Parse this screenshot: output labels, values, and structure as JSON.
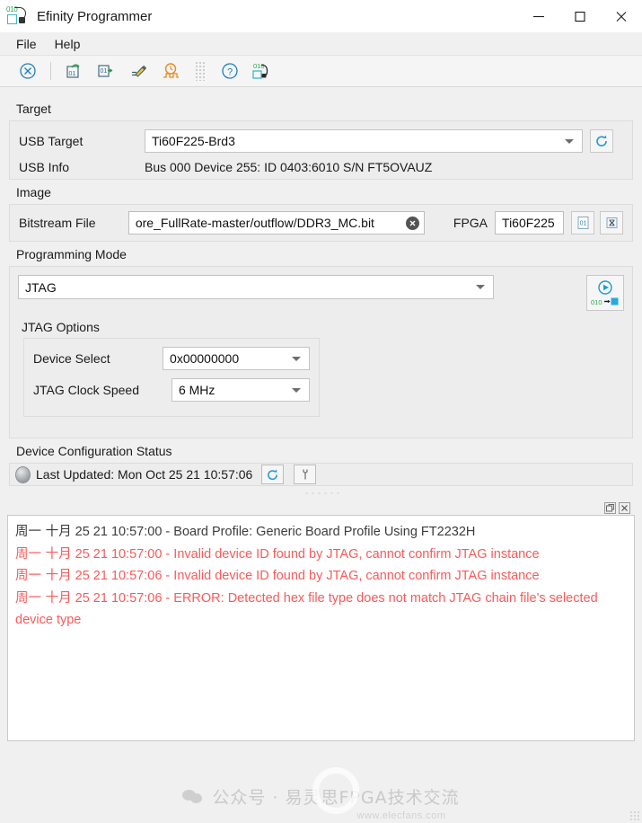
{
  "window": {
    "title": "Efinity Programmer",
    "icon": "efinity-programmer-icon",
    "controls": {
      "minimize": "minimize",
      "maximize": "maximize",
      "close": "close"
    }
  },
  "menubar": {
    "items": [
      {
        "label": "File"
      },
      {
        "label": "Help"
      }
    ]
  },
  "toolbar": {
    "buttons": [
      {
        "name": "stop-button",
        "icon": "circle-x-icon"
      },
      {
        "name": "load-bitstream-button",
        "icon": "open-01-up-arrow-icon"
      },
      {
        "name": "export-bitstream-button",
        "icon": "01-right-arrow-icon"
      },
      {
        "name": "edit-jtag-chain-button",
        "icon": "pencil-edit-icon"
      },
      {
        "name": "timing-button",
        "icon": "clock-waveform-icon"
      },
      {
        "name": "help-button",
        "icon": "question-circle-icon"
      },
      {
        "name": "about-button",
        "icon": "010-plug-icon"
      }
    ]
  },
  "target": {
    "section_label": "Target",
    "usb_target_label": "USB Target",
    "usb_target_value": "Ti60F225-Brd3",
    "refresh_icon": "refresh-icon",
    "usb_info_label": "USB Info",
    "usb_info_value": "Bus 000 Device 255: ID 0403:6010 S/N FT5OVAUZ"
  },
  "image": {
    "section_label": "Image",
    "bitstream_label": "Bitstream File",
    "bitstream_value": "ore_FullRate-master/outflow/DDR3_MC.bit",
    "clear_icon": "clear-circle-x-icon",
    "fpga_label": "FPGA",
    "fpga_value": "Ti60F225",
    "buttons": [
      {
        "name": "select-bitstream-button",
        "icon": "document-01-icon"
      },
      {
        "name": "jtag-chain-button",
        "icon": "device-chain-icon"
      }
    ]
  },
  "programming_mode": {
    "section_label": "Programming Mode",
    "mode_value": "JTAG",
    "start_program_button": {
      "name": "start-program-button",
      "icon": "play-program-icon",
      "badge": "010"
    },
    "options_label": "JTAG Options",
    "fields": [
      {
        "label": "Device Select",
        "value": "0x00000000"
      },
      {
        "label": "JTAG Clock Speed",
        "value": "6 MHz"
      }
    ]
  },
  "device_status": {
    "section_label": "Device Configuration Status",
    "led": "status-led-idle",
    "text": "Last Updated: Mon Oct 25 21 10:57:06",
    "buttons": [
      {
        "name": "refresh-status-button",
        "icon": "refresh-icon"
      },
      {
        "name": "configure-status-button",
        "icon": "wrench-icon"
      }
    ]
  },
  "dock": {
    "float_button": "float-panel-icon",
    "close_button": "close-panel-icon"
  },
  "log": {
    "lines": [
      {
        "timestamp_cjk": "周一 十月",
        "timestamp": "25 21 10:57:00",
        "message": " - Board Profile: Generic Board Profile Using FT2232H",
        "level": "normal"
      },
      {
        "timestamp_cjk": "周一 十月",
        "timestamp": "25 21 10:57:00",
        "message": " - Invalid device ID found by JTAG, cannot confirm JTAG instance",
        "level": "error"
      },
      {
        "timestamp_cjk": "周一 十月",
        "timestamp": "25 21 10:57:06",
        "message": " - Invalid device ID found by JTAG, cannot confirm JTAG instance",
        "level": "error"
      },
      {
        "timestamp_cjk": "周一 十月",
        "timestamp": "25 21 10:57:06",
        "message": " - ERROR: Detected hex file type does not match JTAG chain file's selected device type",
        "level": "error"
      }
    ]
  },
  "watermark": {
    "text": "公众号 · 易灵思FPGA技术交流",
    "url": "www.elecfans.com",
    "icon": "wechat-icon"
  },
  "colors": {
    "accent_blue": "#1e9ad6",
    "error_red": "#fa5a5a",
    "green": "#2fa84f",
    "panel_bg": "#ededed",
    "window_bg": "#f0f0f0"
  }
}
